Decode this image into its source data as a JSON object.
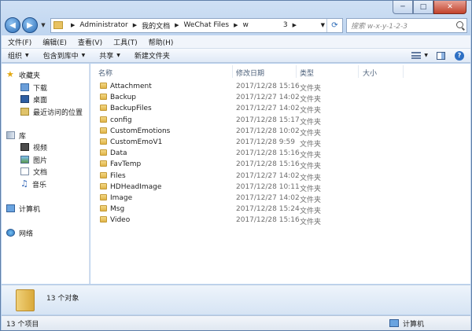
{
  "address": {
    "crumbs": [
      "Administrator",
      "我的文档",
      "WeChat Files",
      "w",
      "3"
    ],
    "search_placeholder": "搜索 w-x-y-1-2-3"
  },
  "menu": [
    "文件(F)",
    "编辑(E)",
    "查看(V)",
    "工具(T)",
    "帮助(H)"
  ],
  "toolbar": {
    "organize": "组织",
    "include_library": "包含到库中",
    "share": "共享",
    "new_folder": "新建文件夹"
  },
  "navpane": {
    "favorites": "收藏夹",
    "downloads": "下载",
    "desktop": "桌面",
    "recent": "最近访问的位置",
    "libraries": "库",
    "videos": "视频",
    "pictures": "图片",
    "documents": "文档",
    "music": "音乐",
    "computer": "计算机",
    "network": "网络"
  },
  "columns": {
    "name": "名称",
    "date": "修改日期",
    "type": "类型",
    "size": "大小"
  },
  "files": [
    {
      "name": "Attachment",
      "date": "2017/12/28 15:16",
      "type": "文件夹"
    },
    {
      "name": "Backup",
      "date": "2017/12/27 14:02",
      "type": "文件夹"
    },
    {
      "name": "BackupFiles",
      "date": "2017/12/27 14:02",
      "type": "文件夹"
    },
    {
      "name": "config",
      "date": "2017/12/28 15:17",
      "type": "文件夹"
    },
    {
      "name": "CustomEmotions",
      "date": "2017/12/28 10:02",
      "type": "文件夹"
    },
    {
      "name": "CustomEmoV1",
      "date": "2017/12/28 9:59",
      "type": "文件夹"
    },
    {
      "name": "Data",
      "date": "2017/12/28 15:16",
      "type": "文件夹"
    },
    {
      "name": "FavTemp",
      "date": "2017/12/28 15:16",
      "type": "文件夹"
    },
    {
      "name": "Files",
      "date": "2017/12/27 14:02",
      "type": "文件夹"
    },
    {
      "name": "HDHeadImage",
      "date": "2017/12/28 10:11",
      "type": "文件夹"
    },
    {
      "name": "Image",
      "date": "2017/12/27 14:02",
      "type": "文件夹"
    },
    {
      "name": "Msg",
      "date": "2017/12/28 15:24",
      "type": "文件夹"
    },
    {
      "name": "Video",
      "date": "2017/12/28 15:16",
      "type": "文件夹"
    }
  ],
  "details": {
    "count": "13 个对象"
  },
  "status": {
    "items": "13 个项目",
    "location": "计算机"
  }
}
